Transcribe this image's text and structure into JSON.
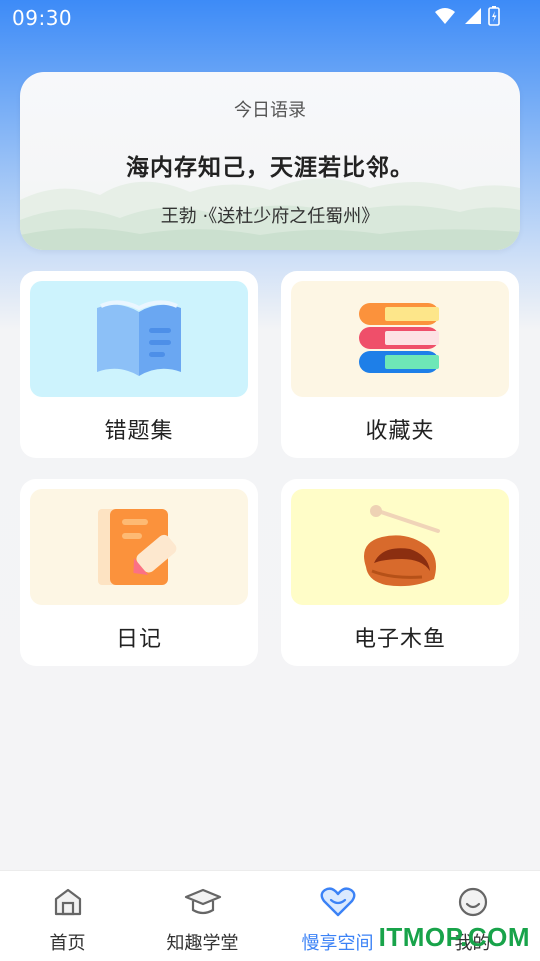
{
  "status_bar": {
    "time": "09:30"
  },
  "quote": {
    "heading": "今日语录",
    "text": "海内存知己，天涯若比邻。",
    "source": "王勃 ·《送杜少府之任蜀州》"
  },
  "tiles": [
    {
      "label": "错题集",
      "icon": "book-icon",
      "bg": "#cdf3fd"
    },
    {
      "label": "收藏夹",
      "icon": "stacked-books-icon",
      "bg": "#fdf6e4"
    },
    {
      "label": "日记",
      "icon": "notebook-pencil-icon",
      "bg": "#fdf6e4"
    },
    {
      "label": "电子木鱼",
      "icon": "wooden-fish-icon",
      "bg": "#fffdc8"
    }
  ],
  "bottom_nav": [
    {
      "label": "首页",
      "icon": "home-icon",
      "active": false
    },
    {
      "label": "知趣学堂",
      "icon": "graduation-cap-icon",
      "active": false
    },
    {
      "label": "慢享空间",
      "icon": "heart-icon",
      "active": true
    },
    {
      "label": "我的",
      "icon": "smiley-icon",
      "active": false
    }
  ],
  "watermark": "ITMOP.COM",
  "colors": {
    "accent": "#3b82f6",
    "watermark": "#18a34a"
  }
}
